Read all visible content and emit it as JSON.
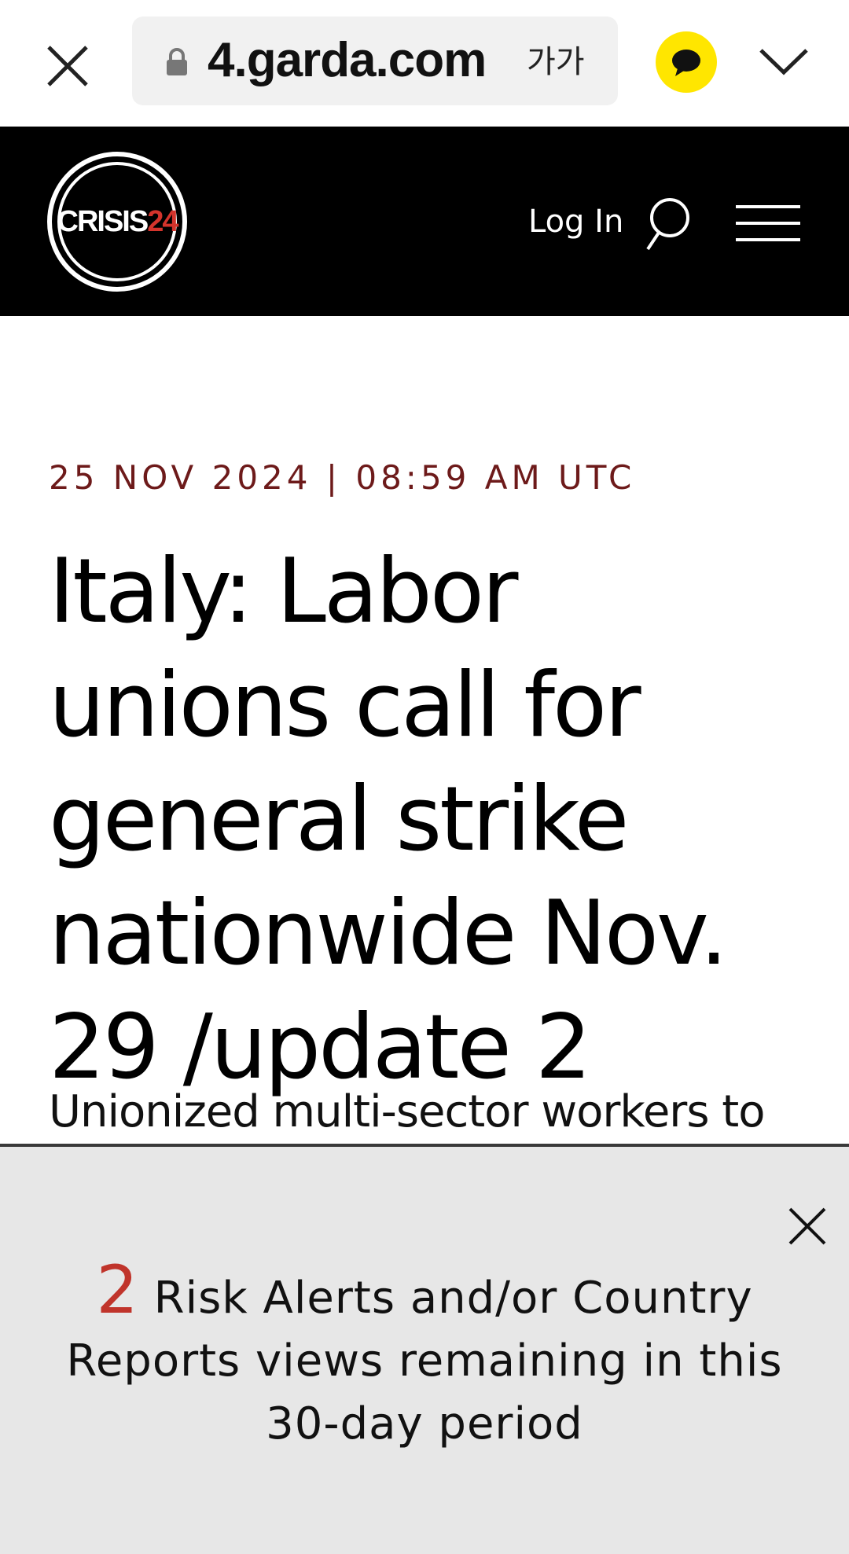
{
  "browser": {
    "url": "4.garda.com",
    "text_size_label": "가가"
  },
  "header": {
    "logo_text_main": "CRISIS",
    "logo_text_accent": "24",
    "login_label": "Log In"
  },
  "article": {
    "date": "25 NOV 2024 | 08:59 AM UTC",
    "title": "Italy: Labor unions call for general strike nationwide Nov. 29 /update 2",
    "summary": "Unionized multi-sector workers to"
  },
  "banner": {
    "count": "2",
    "message": " Risk Alerts and/or Country Reports views remaining in this 30-day period"
  },
  "colors": {
    "date": "#6d1a1a",
    "accent_red": "#c0342b",
    "talk_yellow": "#ffe600",
    "header_bg": "#000000",
    "banner_bg": "#e7e7e7"
  },
  "icons": {
    "browser_close": "close-icon",
    "lock": "lock-icon",
    "talk": "chat-bubble-icon",
    "expand": "chevron-down-icon",
    "search": "search-icon",
    "menu": "hamburger-menu-icon",
    "banner_close": "close-icon"
  }
}
